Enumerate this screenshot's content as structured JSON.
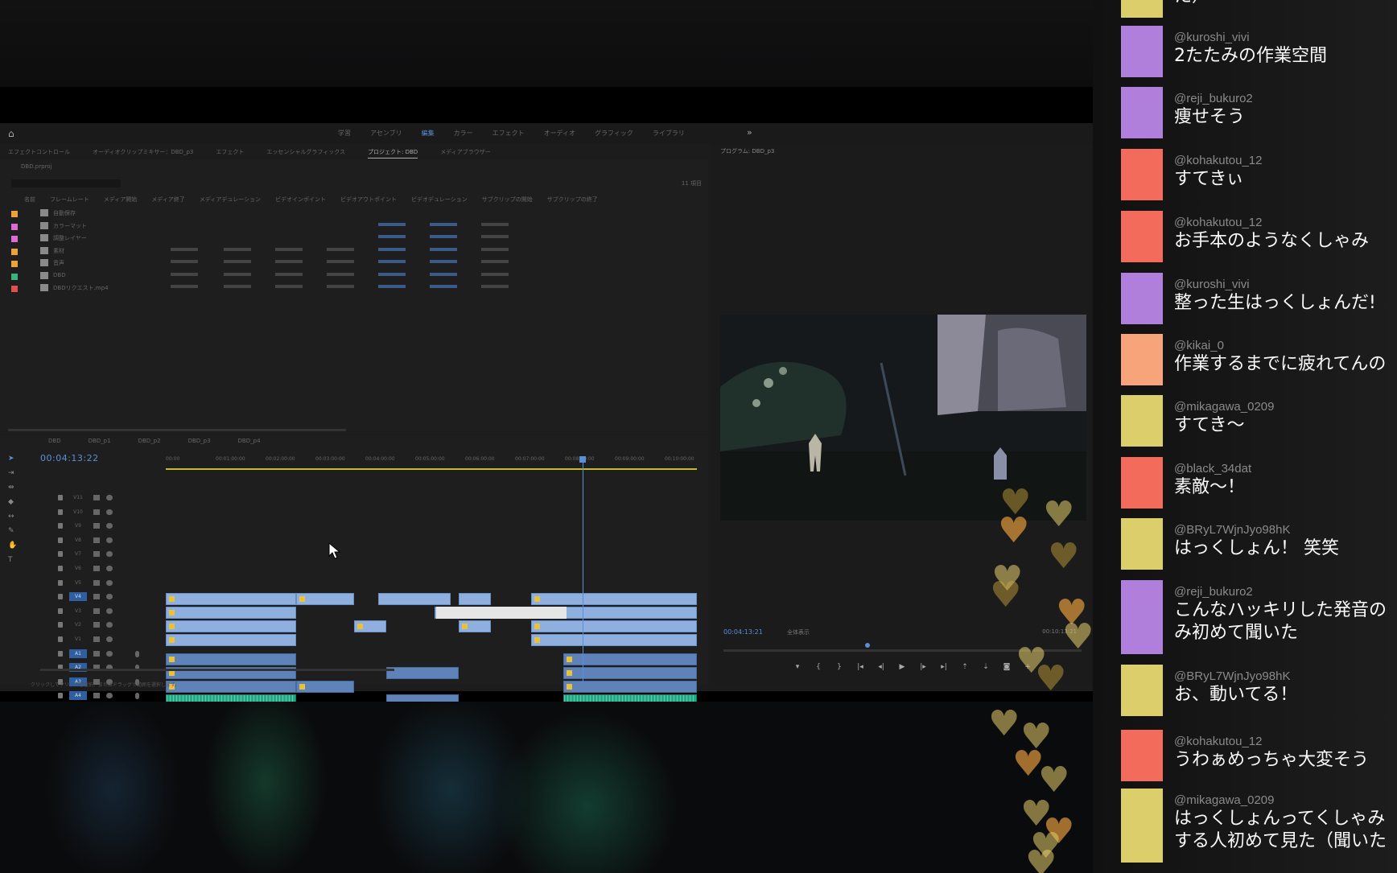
{
  "premiere": {
    "workspace_tabs": [
      "学習",
      "アセンブリ",
      "編集",
      "カラー",
      "エフェクト",
      "オーディオ",
      "グラフィック",
      "ライブラリ"
    ],
    "active_workspace_index": 2,
    "more_icon": "»",
    "panel_tabs": [
      "エフェクトコントロール",
      "オーディオクリップミキサー：DBD_p3",
      "エフェクト",
      "エッセンシャルグラフィックス",
      "プロジェクト: DBD",
      "メディアブラウザー"
    ],
    "active_panel_tab_index": 4,
    "project_path": "DBD.prproj",
    "project_item_count": "11 項目",
    "project_columns": [
      "名前",
      "フレームレート",
      "メディア開始",
      "メディア終了",
      "メディアデュレーション",
      "ビデオインポイント",
      "ビデオアウトポイント",
      "ビデオデュレーション",
      "サブクリップの開始",
      "サブクリップの終了"
    ],
    "project_rows": [
      {
        "name": "自動保存",
        "swatch": "#e8a43a",
        "icon": "folder"
      },
      {
        "name": "カラーマット",
        "swatch": "#d86fd0",
        "icon": "matte"
      },
      {
        "name": "調整レイヤー",
        "swatch": "#d86fd0",
        "icon": "adjust"
      },
      {
        "name": "素材",
        "swatch": "#e8a43a",
        "icon": "folder"
      },
      {
        "name": "音声",
        "swatch": "#e8a43a",
        "icon": "folder"
      },
      {
        "name": "DBD",
        "swatch": "#3bb37a",
        "icon": "sequence"
      },
      {
        "name": "DBDリクエスト.mp4",
        "swatch": "#e05050",
        "icon": "clip"
      }
    ],
    "sequence_tabs": [
      "DBD",
      "DBD_p1",
      "DBD_p2",
      "DBD_p3",
      "DBD_p4"
    ],
    "timecode": "00:04:13:22",
    "ruler_labels": [
      "00:00",
      "00:01:00:00",
      "00:02:00:00",
      "00:03:00:00",
      "00:04:00:00",
      "00:05:00:00",
      "00:06:00:00",
      "00:07:00:00",
      "00:08:00:00",
      "00:09:00:00",
      "00:10:00:00"
    ],
    "video_tracks": [
      "V11",
      "V10",
      "V9",
      "V8",
      "V7",
      "V6",
      "V5",
      "V4",
      "V3",
      "V2",
      "V1"
    ],
    "audio_tracks": [
      "A1",
      "A2",
      "A3",
      "A4",
      "A5",
      "A6",
      "A7",
      "A8",
      "A9",
      "A10",
      "A11"
    ],
    "status_text": "クリックしてクリップを選択、またはドラッグで範囲を選択します。",
    "program_monitor_title": "プログラム: DBD_p3",
    "pm_timecode": "00:04:13:21",
    "pm_zoom": "全体表示",
    "pm_quality": "1/2",
    "pm_duration": "00:10:13:21"
  },
  "chat": [
    {
      "user": "",
      "text": "た）",
      "color": "#dccf6b"
    },
    {
      "user": "@kuroshi_vivi",
      "text": "2たたみの作業空間",
      "color": "#b07fdc"
    },
    {
      "user": "@reji_bukuro2",
      "text": "痩せそう",
      "color": "#b07fdc"
    },
    {
      "user": "@kohakutou_12",
      "text": "すてきぃ",
      "color": "#f26b5b"
    },
    {
      "user": "@kohakutou_12",
      "text": "お手本のようなくしゃみ",
      "color": "#f26b5b"
    },
    {
      "user": "@kuroshi_vivi",
      "text": "整った生はっくしょんだ!",
      "color": "#b07fdc"
    },
    {
      "user": "@kikai_0",
      "text": "作業するまでに疲れてんの",
      "color": "#f7a47a"
    },
    {
      "user": "@mikagawa_0209",
      "text": "すてき～",
      "color": "#dccf6b"
    },
    {
      "user": "@black_34dat",
      "text": "素敵～！",
      "color": "#f26b5b"
    },
    {
      "user": "@BRyL7WjnJyo98hK",
      "text": "はっくしょん！ 笑笑",
      "color": "#dccf6b"
    },
    {
      "user": "@reji_bukuro2",
      "text": "こんなハッキリした発音の\nみ初めて聞いた",
      "color": "#b07fdc"
    },
    {
      "user": "@BRyL7WjnJyo98hK",
      "text": "お、動いてる！",
      "color": "#dccf6b"
    },
    {
      "user": "@kohakutou_12",
      "text": "うわぁめっちゃ大変そう",
      "color": "#f26b5b"
    },
    {
      "user": "@mikagawa_0209",
      "text": "はっくしょんってくしゃみ\nする人初めて見た（聞いた",
      "color": "#dccf6b"
    }
  ]
}
